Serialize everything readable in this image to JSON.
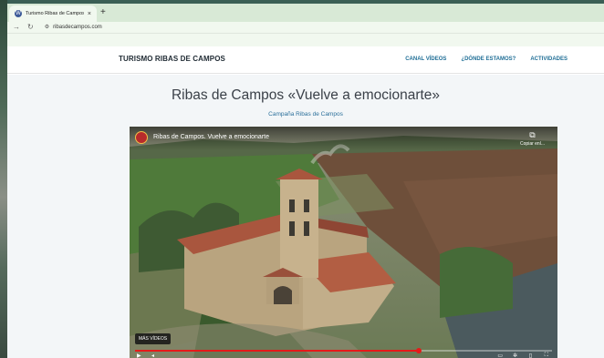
{
  "browser": {
    "tab_title": "Turismo Ribas de Campos",
    "tab_close": "×",
    "new_tab": "+",
    "url": "ribasdecampos.com",
    "favicon_glyph": "W"
  },
  "site": {
    "title": "TURISMO RIBAS DE CAMPOS",
    "nav": [
      "CANAL VÍDEOS",
      "¿DÓNDE ESTAMOS?",
      "ACTIVIDADES"
    ]
  },
  "page": {
    "title": "Ribas de Campos «Vuelve a emocionarte»",
    "subtitle": "Campaña Ribas de Campos"
  },
  "video": {
    "title": "Ribas de Campos. Vuelve a emocionarte",
    "copy_label": "Copiar enl...",
    "more_videos": "MÁS VÍDEOS",
    "progress_fraction": 0.68
  },
  "icons": {
    "back": "back-arrow-icon",
    "reload": "reload-icon",
    "site_info": "site-info-icon",
    "copy": "copy-link-icon",
    "play": "play-icon",
    "volume": "volume-icon",
    "subtitles": "subtitles-icon",
    "settings": "settings-icon",
    "fullscreen": "fullscreen-icon"
  },
  "colors": {
    "nav_link": "#1f6e96",
    "progress": "#e61919",
    "tab_strip": "#d8e9d6"
  }
}
